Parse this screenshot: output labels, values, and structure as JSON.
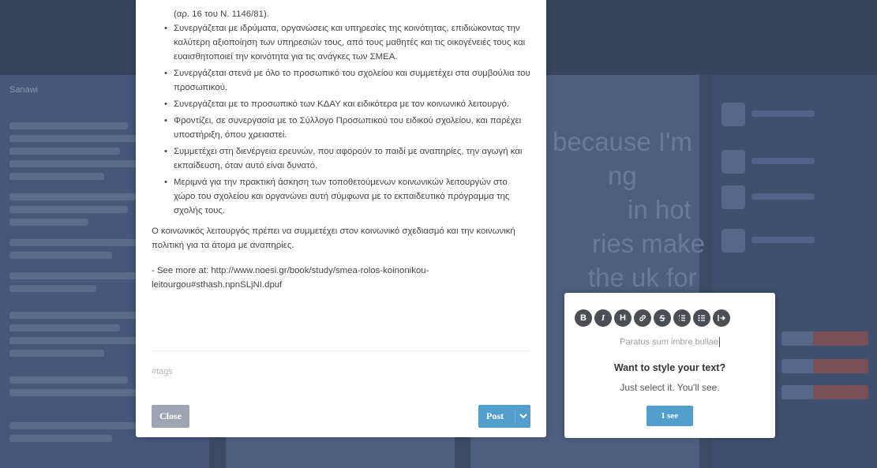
{
  "background": {
    "left_panel_title": "Sanawi",
    "big_text_lines": [
      "because I'm",
      "ng",
      "in hot",
      "ries make",
      "the uk for"
    ]
  },
  "editor": {
    "top_line": "(αρ. 16 του Ν. 1146/81).",
    "bullets": [
      "Συνεργάζεται με ιδρύματα, οργανώσεις και υπηρεσίες της κοινότητας, επιδιώκοντας την καλύτερη αξιοποίηση των υπηρεσιών τους, από τους μαθητές και τις οικογένειές τους και ευαισθητοποιεί την κοινότητα για τις ανάγκες των ΣΜΕΑ.",
      "Συνεργάζεται στενά με όλο το προσωπικό του σχολείου και συμμετέχει στα συμβούλια του προσωπικού.",
      "Συνεργάζεται με το προσωπικό των ΚΔΑΥ και ειδικότερα με τον κοινωνικό λειτουργό.",
      "Φροντίζει, σε συνεργασία με το Σύλλογο Προσωπικού του ειδικού σχολείου, και παρέχει υποστήριξη, όπου χρειαστεί.",
      "Συμμετέχει στη διενέργεια ερευνών, που αφορούν το παιδί με αναπηρίες, την αγωγή και εκπαίδευση, όταν αυτό είναι δυνατό.",
      "Μεριμνά για την πρακτική άσκηση των τοποθετούμενων κοινωνικών λειτουργών στο χώρο του σχολείου και οργανώνει αυτή σύμφωνα με το εκπαιδευτικό πρόγραμμα της σχολής τους."
    ],
    "paragraph": "Ο κοινωνικός λειτουργός πρέπει να συμμετέχει στον κοινωνικό σχεδιασμό και την κοινωνική πολιτική για τα άτομα με αναπηρίες.",
    "see_more": "- See more at: http://www.noesi.gr/book/study/smea-rolos-koinonikou-leitourgou#sthash.npnSLjNI.dpuf",
    "tags_placeholder": "#tags",
    "close_label": "Close",
    "post_label": "Post"
  },
  "tooltip": {
    "toolbar": [
      {
        "icon": "bold-icon",
        "glyph": "B"
      },
      {
        "icon": "italic-icon",
        "glyph": "I"
      },
      {
        "icon": "heading-icon",
        "glyph": "H"
      },
      {
        "icon": "link-icon",
        "glyph": ""
      },
      {
        "icon": "strikethrough-icon",
        "glyph": ""
      },
      {
        "icon": "numbered-list-icon",
        "glyph": ""
      },
      {
        "icon": "bulleted-list-icon",
        "glyph": ""
      },
      {
        "icon": "read-more-icon",
        "glyph": ""
      }
    ],
    "sample_text": "Paratus sum imbre bullae",
    "title": "Want to style your text?",
    "subtitle": "Just select it. You'll see.",
    "button_label": "I see"
  },
  "colors": {
    "accent": "#529ecc",
    "close_button": "#9ca5b1",
    "backdrop": "#3b4b63"
  }
}
